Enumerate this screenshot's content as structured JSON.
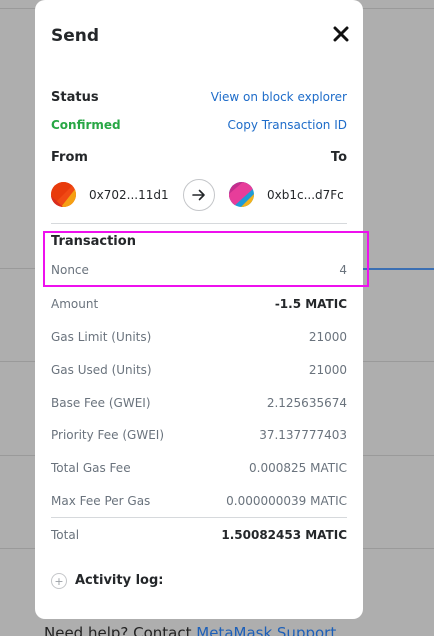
{
  "background": {
    "help_text": "Need help? Contact",
    "help_link": "MetaMask Support"
  },
  "modal": {
    "title": "Send",
    "close_icon": "close-icon",
    "status": {
      "label": "Status",
      "value": "Confirmed",
      "view_explorer": "View on block explorer",
      "copy_tx_id": "Copy Transaction ID"
    },
    "from": {
      "label": "From",
      "address": "0x702...11d1"
    },
    "to": {
      "label": "To",
      "address": "0xb1c...d7Fc"
    },
    "transaction": {
      "label": "Transaction",
      "nonce_label": "Nonce",
      "nonce_value": "4"
    },
    "details": [
      {
        "label": "Amount",
        "value": "-1.5 MATIC"
      },
      {
        "label": "Gas Limit (Units)",
        "value": "21000"
      },
      {
        "label": "Gas Used (Units)",
        "value": "21000"
      },
      {
        "label": "Base Fee (GWEI)",
        "value": "2.125635674"
      },
      {
        "label": "Priority Fee (GWEI)",
        "value": "37.137777403"
      },
      {
        "label": "Total Gas Fee",
        "value": "0.000825 MATIC"
      },
      {
        "label": "Max Fee Per Gas",
        "value": "0.000000039 MATIC"
      }
    ],
    "total": {
      "label": "Total",
      "value": "1.50082453 MATIC"
    },
    "activity_log": "Activity log:"
  },
  "colors": {
    "confirmed": "#28a745",
    "link": "#1e6cc9",
    "highlight": "#ee10ee"
  }
}
